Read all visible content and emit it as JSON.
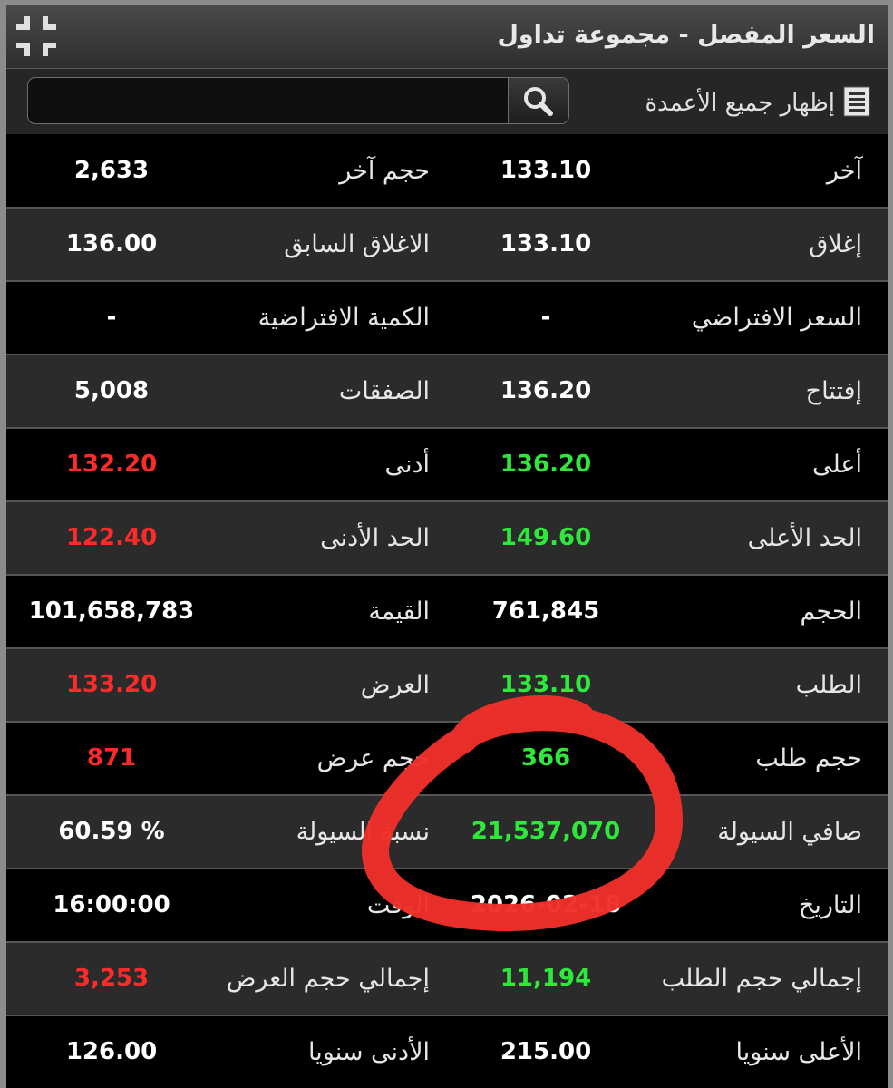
{
  "window": {
    "title": "السعر المفصل - مجموعة تداول"
  },
  "toolbar": {
    "search_value": "",
    "show_columns_label": "إظهار جميع الأعمدة"
  },
  "rows": [
    {
      "label1": "آخر",
      "value1": "133.10",
      "color1": "white",
      "label2": "حجم آخر",
      "value2": "2,633",
      "color2": "white"
    },
    {
      "label1": "إغلاق",
      "value1": "133.10",
      "color1": "white",
      "label2": "الاغلاق السابق",
      "value2": "136.00",
      "color2": "white"
    },
    {
      "label1": "السعر الافتراضي",
      "value1": "-",
      "color1": "white",
      "label2": "الكمية الافتراضية",
      "value2": "-",
      "color2": "white"
    },
    {
      "label1": "إفتتاح",
      "value1": "136.20",
      "color1": "white",
      "label2": "الصفقات",
      "value2": "5,008",
      "color2": "white"
    },
    {
      "label1": "أعلى",
      "value1": "136.20",
      "color1": "green",
      "label2": "أدنى",
      "value2": "132.20",
      "color2": "red"
    },
    {
      "label1": "الحد الأعلى",
      "value1": "149.60",
      "color1": "green",
      "label2": "الحد الأدنى",
      "value2": "122.40",
      "color2": "red"
    },
    {
      "label1": "الحجم",
      "value1": "761,845",
      "color1": "white",
      "label2": "القيمة",
      "value2": "101,658,783",
      "color2": "white"
    },
    {
      "label1": "الطلب",
      "value1": "133.10",
      "color1": "green",
      "label2": "العرض",
      "value2": "133.20",
      "color2": "red"
    },
    {
      "label1": "حجم طلب",
      "value1": "366",
      "color1": "green",
      "label2": "حجم عرض",
      "value2": "871",
      "color2": "red"
    },
    {
      "label1": "صافي السيولة",
      "value1": "21,537,070",
      "color1": "green",
      "label2": "نسبة السيولة",
      "value2": "60.59 %",
      "color2": "white"
    },
    {
      "label1": "التاريخ",
      "value1": "2026-02-18",
      "color1": "white",
      "label2": "الوقت",
      "value2": "16:00:00",
      "color2": "white"
    },
    {
      "label1": "إجمالي حجم الطلب",
      "value1": "11,194",
      "color1": "green",
      "label2": "إجمالي حجم العرض",
      "value2": "3,253",
      "color2": "red"
    },
    {
      "label1": "الأعلى سنويا",
      "value1": "215.00",
      "color1": "white",
      "label2": "الأدنى سنويا",
      "value2": "126.00",
      "color2": "white"
    }
  ],
  "colors": {
    "positive": "#2ee83a",
    "negative": "#ff2a2a",
    "neutral": "#ffffff",
    "annotation": "#f0302a"
  },
  "icons": {
    "collapse": "collapse-icon",
    "search": "magnifier-icon",
    "columns": "list-icon"
  }
}
